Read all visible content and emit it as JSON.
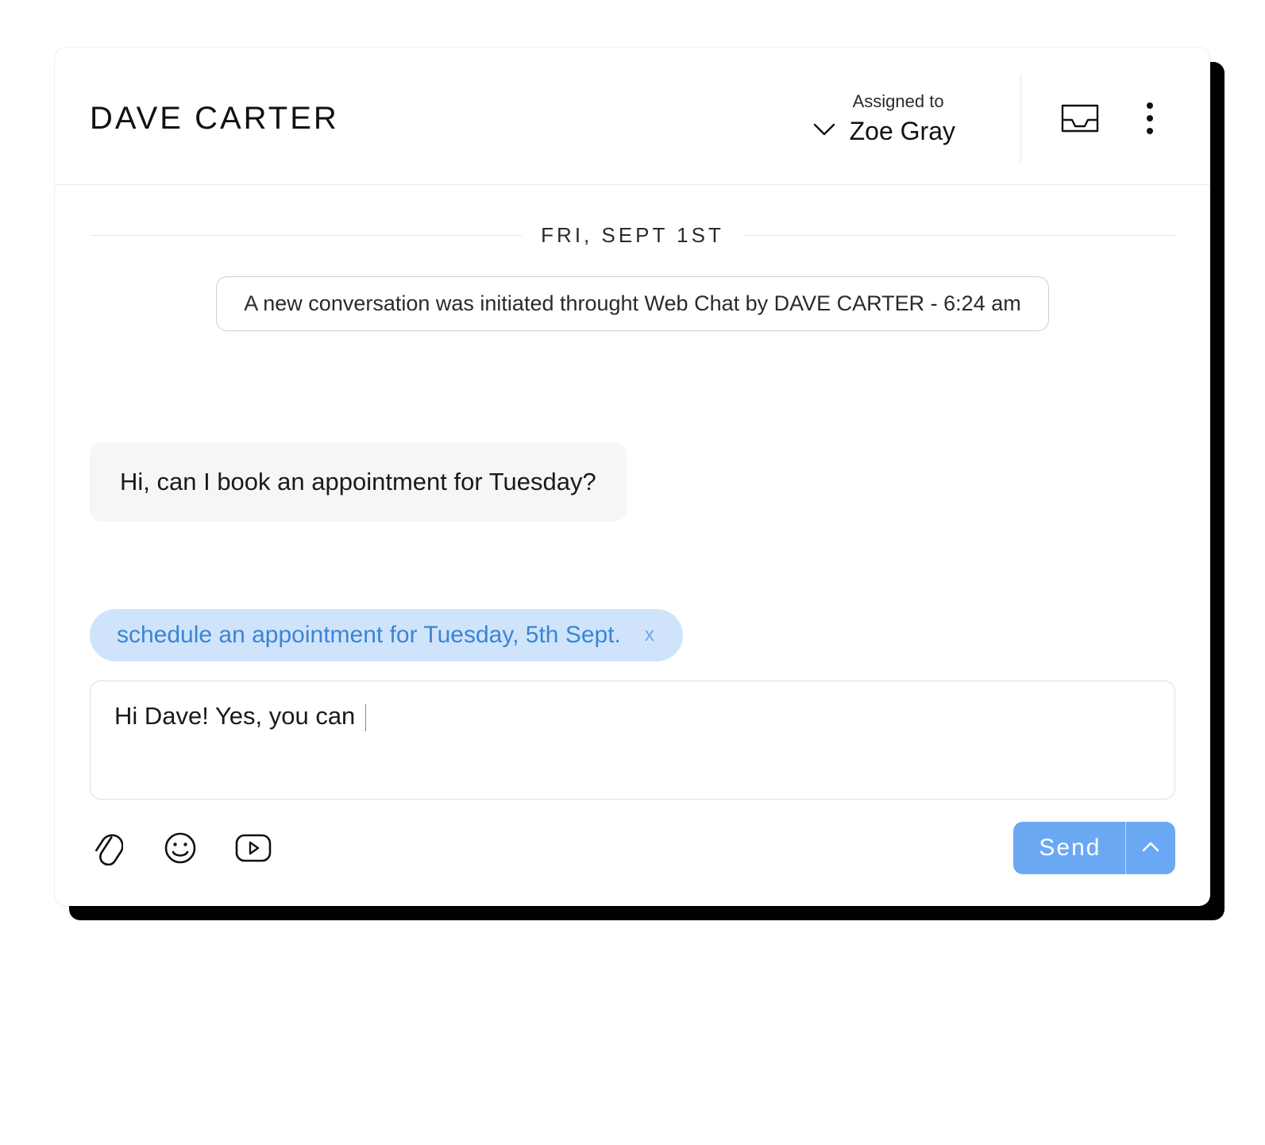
{
  "header": {
    "contact_name": "DAVE CARTER",
    "assigned_to_label": "Assigned to",
    "assigned_to_name": "Zoe Gray"
  },
  "date_divider": "FRI, SEPT 1ST",
  "system_notice": "A new conversation was initiated throught Web Chat by DAVE CARTER - 6:24 am",
  "messages": [
    {
      "from": "contact",
      "text": "Hi, can I book an appointment for Tuesday?"
    }
  ],
  "suggestion": {
    "text": "schedule an appointment for Tuesday, 5th Sept.",
    "dismiss_label": "x"
  },
  "composer": {
    "draft_text": "Hi Dave! Yes, you can "
  },
  "toolbar": {
    "send_label": "Send"
  }
}
